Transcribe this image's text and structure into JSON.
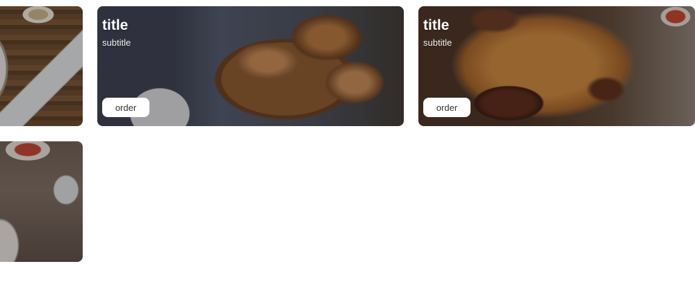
{
  "cards": [
    {
      "image": "dining-table-photo",
      "title": "",
      "subtitle": "",
      "order_label": ""
    },
    {
      "image": "croissants-basket-photo",
      "title": "title",
      "subtitle": "subtitle",
      "order_label": "order"
    },
    {
      "image": "chicken-rice-photo",
      "title": "title",
      "subtitle": "subtitle",
      "order_label": "order"
    },
    {
      "image": "salad-plates-photo",
      "title": "",
      "subtitle": "",
      "order_label": ""
    }
  ]
}
